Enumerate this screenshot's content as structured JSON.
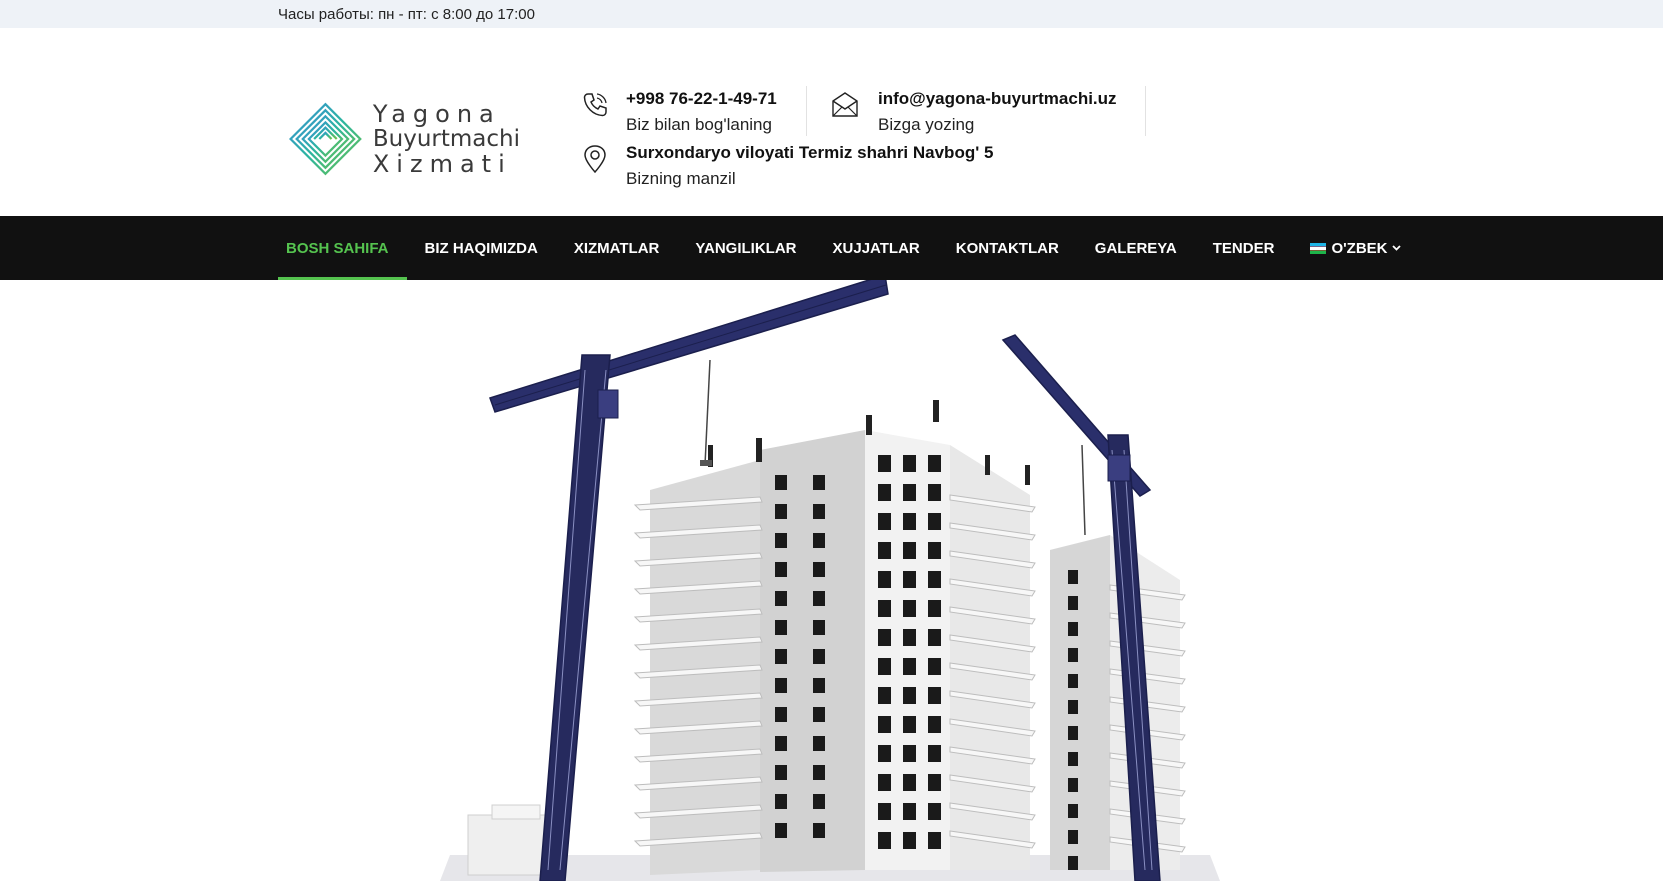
{
  "topbar": {
    "hours": "Часы работы: пн - пт: с 8:00 до 17:00"
  },
  "logo": {
    "line1": "Yagona",
    "line2": "Buyurtmachi",
    "line3": "Xizmati",
    "icon": "diamond-logo-icon",
    "colors": [
      "#3a8fd8",
      "#2cb5a0",
      "#6cc24a"
    ]
  },
  "contacts": {
    "phone": {
      "icon": "phone-icon",
      "title": "+998 76-22-1-49-71",
      "subtitle": "Biz bilan bog'laning"
    },
    "email": {
      "icon": "envelope-icon",
      "title": "info@yagona-buyurtmachi.uz",
      "subtitle": "Bizga yozing"
    },
    "address": {
      "icon": "map-pin-icon",
      "title": "Surxondaryo viloyati Termiz shahri Navbog' 5",
      "subtitle": "Bizning manzil"
    }
  },
  "nav": {
    "items": [
      {
        "label": "BOSH SAHIFA",
        "active": true
      },
      {
        "label": "BIZ HAQIMIZDA"
      },
      {
        "label": "XIZMATLAR"
      },
      {
        "label": "YANGILIKLAR"
      },
      {
        "label": "XUJJATLAR"
      },
      {
        "label": "KONTAKTLAR"
      },
      {
        "label": "GALEREYA"
      },
      {
        "label": "TENDER"
      }
    ],
    "language": {
      "label": "O'ZBEK",
      "icon": "uzbek-flag-icon",
      "dropdown_icon": "chevron-down-icon"
    },
    "accent_color": "#55c34f",
    "background": "#111111"
  },
  "hero": {
    "image": "building-construction-cranes-illustration"
  }
}
